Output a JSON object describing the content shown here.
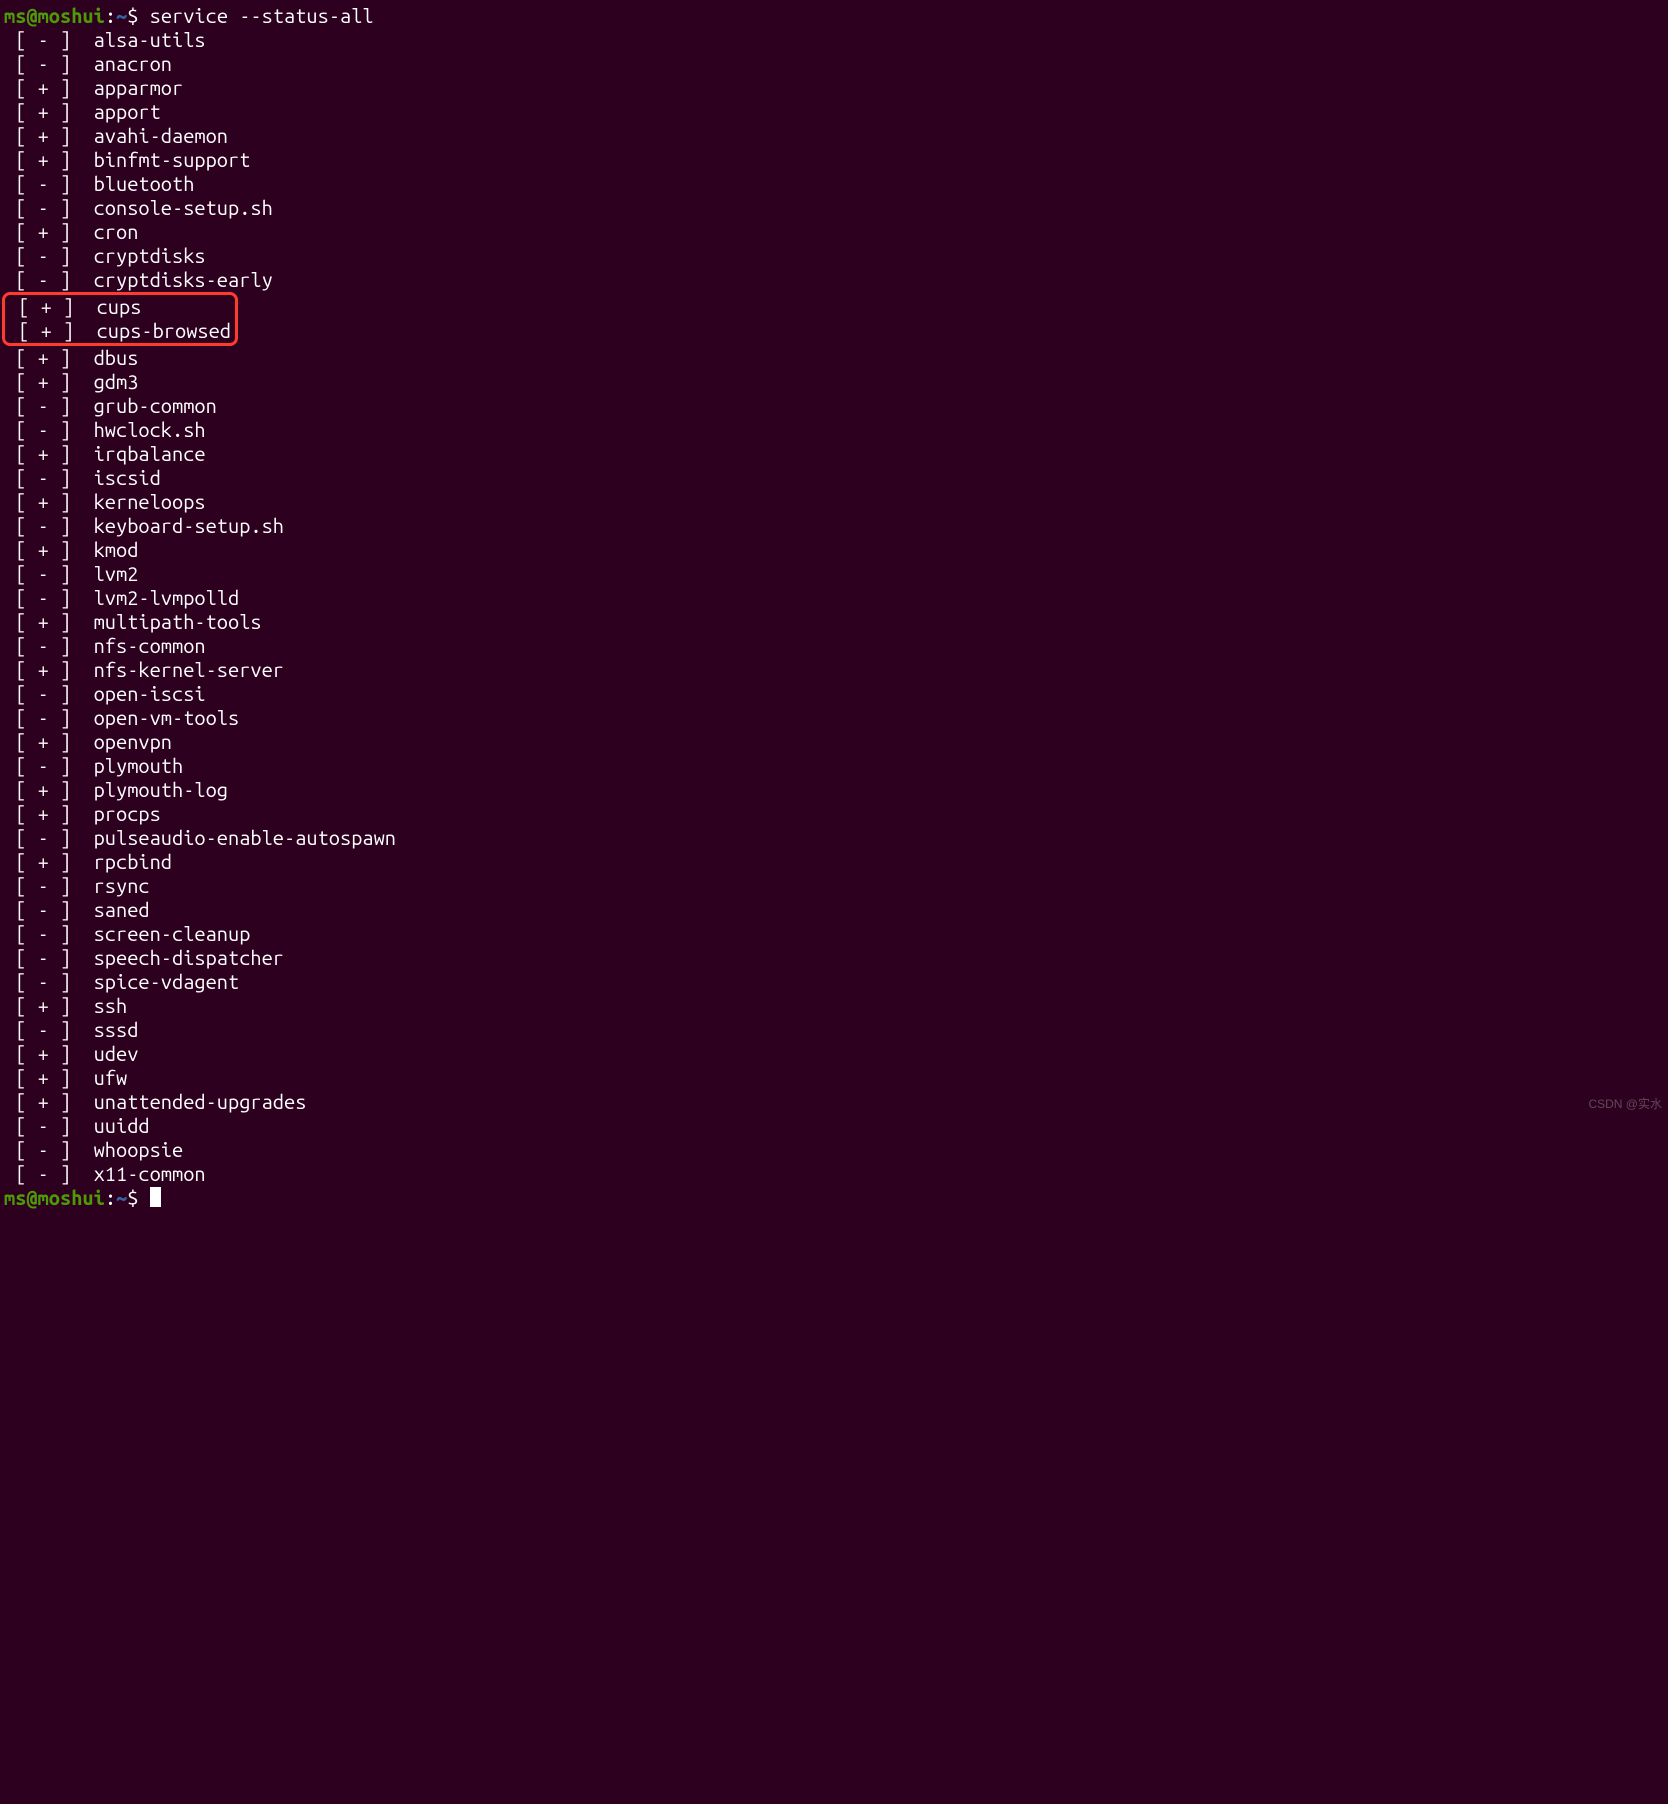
{
  "prompt": {
    "user": "ms",
    "at": "@",
    "host": "moshui",
    "colon": ":",
    "path": "~",
    "dollar": "$"
  },
  "command": "service --status-all",
  "services": [
    {
      "status": "-",
      "name": "alsa-utils"
    },
    {
      "status": "-",
      "name": "anacron"
    },
    {
      "status": "+",
      "name": "apparmor"
    },
    {
      "status": "+",
      "name": "apport"
    },
    {
      "status": "+",
      "name": "avahi-daemon"
    },
    {
      "status": "+",
      "name": "binfmt-support"
    },
    {
      "status": "-",
      "name": "bluetooth"
    },
    {
      "status": "-",
      "name": "console-setup.sh"
    },
    {
      "status": "+",
      "name": "cron"
    },
    {
      "status": "-",
      "name": "cryptdisks"
    },
    {
      "status": "-",
      "name": "cryptdisks-early"
    },
    {
      "status": "+",
      "name": "cups",
      "highlighted": true
    },
    {
      "status": "+",
      "name": "cups-browsed",
      "highlighted": true
    },
    {
      "status": "+",
      "name": "dbus"
    },
    {
      "status": "+",
      "name": "gdm3"
    },
    {
      "status": "-",
      "name": "grub-common"
    },
    {
      "status": "-",
      "name": "hwclock.sh"
    },
    {
      "status": "+",
      "name": "irqbalance"
    },
    {
      "status": "-",
      "name": "iscsid"
    },
    {
      "status": "+",
      "name": "kerneloops"
    },
    {
      "status": "-",
      "name": "keyboard-setup.sh"
    },
    {
      "status": "+",
      "name": "kmod"
    },
    {
      "status": "-",
      "name": "lvm2"
    },
    {
      "status": "-",
      "name": "lvm2-lvmpolld"
    },
    {
      "status": "+",
      "name": "multipath-tools"
    },
    {
      "status": "-",
      "name": "nfs-common"
    },
    {
      "status": "+",
      "name": "nfs-kernel-server"
    },
    {
      "status": "-",
      "name": "open-iscsi"
    },
    {
      "status": "-",
      "name": "open-vm-tools"
    },
    {
      "status": "+",
      "name": "openvpn"
    },
    {
      "status": "-",
      "name": "plymouth"
    },
    {
      "status": "+",
      "name": "plymouth-log"
    },
    {
      "status": "+",
      "name": "procps"
    },
    {
      "status": "-",
      "name": "pulseaudio-enable-autospawn"
    },
    {
      "status": "+",
      "name": "rpcbind"
    },
    {
      "status": "-",
      "name": "rsync"
    },
    {
      "status": "-",
      "name": "saned"
    },
    {
      "status": "-",
      "name": "screen-cleanup"
    },
    {
      "status": "-",
      "name": "speech-dispatcher"
    },
    {
      "status": "-",
      "name": "spice-vdagent"
    },
    {
      "status": "+",
      "name": "ssh"
    },
    {
      "status": "-",
      "name": "sssd"
    },
    {
      "status": "+",
      "name": "udev"
    },
    {
      "status": "+",
      "name": "ufw"
    },
    {
      "status": "+",
      "name": "unattended-upgrades"
    },
    {
      "status": "-",
      "name": "uuidd"
    },
    {
      "status": "-",
      "name": "whoopsie"
    },
    {
      "status": "-",
      "name": "x11-common"
    }
  ],
  "watermark": "CSDN @实水"
}
